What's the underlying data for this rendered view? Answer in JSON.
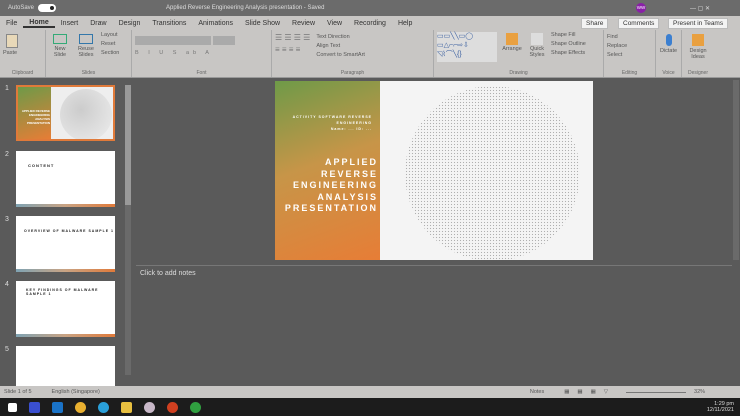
{
  "titlebar": {
    "autosave": "AutoSave",
    "toggle": "On",
    "doc_title": "Applied Reverse Engineering Analysis presentation - Saved",
    "user_initials": "WW"
  },
  "tabs": [
    "File",
    "Home",
    "Insert",
    "Draw",
    "Design",
    "Transitions",
    "Animations",
    "Slide Show",
    "Review",
    "View",
    "Recording",
    "Help"
  ],
  "actions": {
    "share": "Share",
    "comments": "Comments",
    "present": "Present in Teams"
  },
  "ribbon": {
    "clipboard": {
      "paste": "Paste",
      "label": "Clipboard"
    },
    "slides": {
      "new": "New Slide",
      "reuse": "Reuse Slides",
      "layout": "Layout",
      "reset": "Reset",
      "section": "Section",
      "label": "Slides"
    },
    "font": {
      "label": "Font"
    },
    "paragraph": {
      "text_direction": "Text Direction",
      "align_text": "Align Text",
      "smartart": "Convert to SmartArt",
      "label": "Paragraph"
    },
    "drawing": {
      "arrange": "Arrange",
      "quick_styles": "Quick Styles",
      "fill": "Shape Fill",
      "outline": "Shape Outline",
      "effects": "Shape Effects",
      "label": "Drawing"
    },
    "editing": {
      "find": "Find",
      "replace": "Replace",
      "select": "Select",
      "label": "Editing"
    },
    "voice": {
      "dictate": "Dictate",
      "label": "Voice"
    },
    "designer": {
      "ideas": "Design Ideas",
      "label": "Designer"
    }
  },
  "thumbs": [
    {
      "n": "1",
      "title": "APPLIED REVERSE ENGINEERING ANALYSIS PRESENTATION"
    },
    {
      "n": "2",
      "title": "CONTENT"
    },
    {
      "n": "3",
      "title": "OVERVIEW OF MALWARE SAMPLE 1"
    },
    {
      "n": "4",
      "title": "KEY FINDINGS OF MALWARE SAMPLE 1"
    },
    {
      "n": "5",
      "title": ""
    }
  ],
  "slide": {
    "subtitle1": "ACTIVITY SOFTWARE REVERSE ENGINEERING",
    "subtitle2": "Name: ... ID: ...",
    "title_lines": [
      "APPLIED",
      "REVERSE",
      "ENGINEERING",
      "ANALYSIS",
      "PRESENTATION"
    ]
  },
  "notes": {
    "placeholder": "Click to add notes"
  },
  "status": {
    "slide": "Slide 1 of 5",
    "lang": "English (Singapore)",
    "notes": "Notes",
    "zoom": "32%"
  },
  "taskbar": {
    "time": "1:29 pm",
    "date": "12/11/2021",
    "icons": [
      "windows-icon",
      "visual-studio-icon",
      "outlook-icon",
      "chrome-icon",
      "telegram-icon",
      "file-explorer-icon",
      "app-icon",
      "powerpoint-icon",
      "green-app-icon"
    ]
  }
}
